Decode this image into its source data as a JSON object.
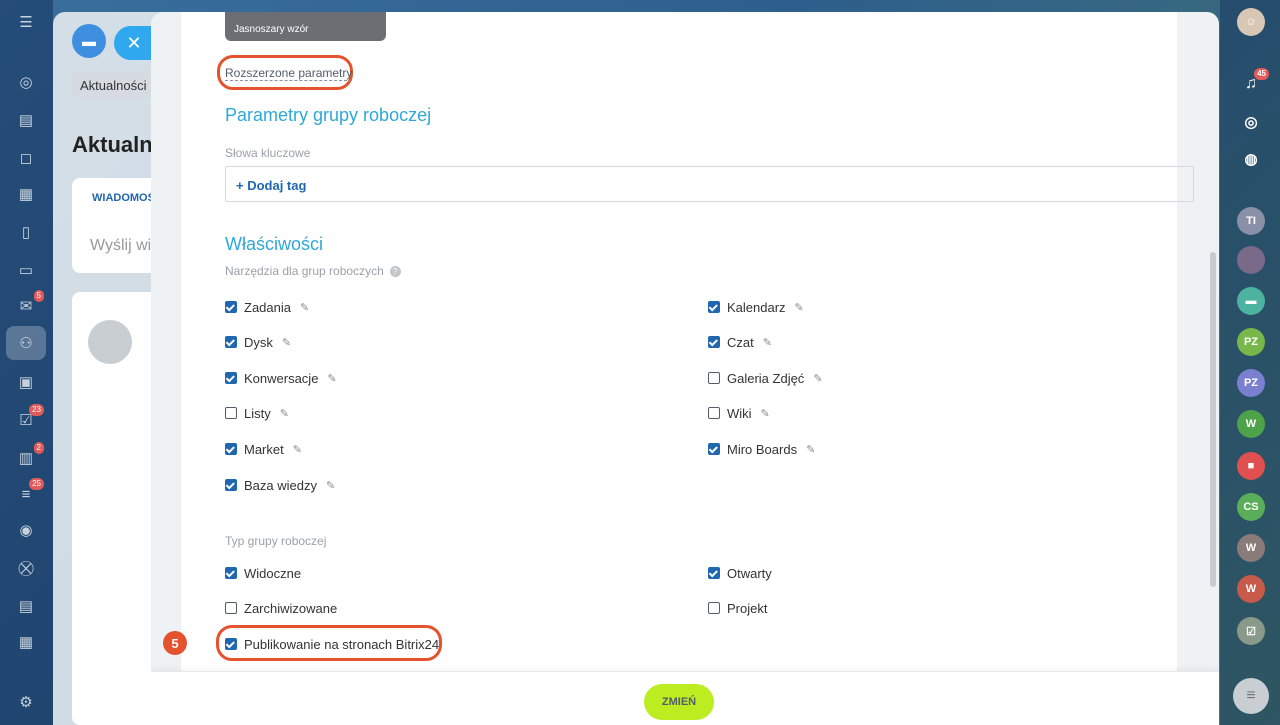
{
  "background": {
    "tab_label": "Aktualności",
    "page_title": "Aktualności",
    "card_tab": "WIADOMOŚĆ",
    "card_placeholder": "Wyślij wiadomość"
  },
  "left_sidebar": {
    "badges": {
      "mail": "5",
      "tasks": "23",
      "calendar2": "2",
      "funnel": "25"
    }
  },
  "right_sidebar": {
    "notifications_badge": "45",
    "avatars": [
      "TI",
      "PZ",
      "PZ",
      "W",
      "CS",
      "W",
      "W"
    ]
  },
  "modal": {
    "preset_label": "Jasnoszary wzór",
    "advanced_link": "Rozszerzone parametry",
    "group_params_title": "Parametry grupy roboczej",
    "keywords_label": "Słowa kluczowe",
    "add_tag_label": "+ Dodaj tag",
    "properties_title": "Właściwości",
    "tools_label": "Narzędzia dla grup roboczych",
    "tools": [
      {
        "label": "Zadania",
        "checked": true
      },
      {
        "label": "Dysk",
        "checked": true
      },
      {
        "label": "Konwersacje",
        "checked": true
      },
      {
        "label": "Listy",
        "checked": false
      },
      {
        "label": "Market",
        "checked": true
      },
      {
        "label": "Baza wiedzy",
        "checked": true
      },
      {
        "label": "Kalendarz",
        "checked": true
      },
      {
        "label": "Czat",
        "checked": true
      },
      {
        "label": "Galeria Zdjęć",
        "checked": false
      },
      {
        "label": "Wiki",
        "checked": false
      },
      {
        "label": "Miro Boards",
        "checked": true
      }
    ],
    "type_label": "Typ grupy roboczej",
    "types": [
      {
        "label": "Widoczne",
        "checked": true
      },
      {
        "label": "Zarchiwizowane",
        "checked": false
      },
      {
        "label": "Publikowanie na stronach Bitrix24",
        "checked": true
      },
      {
        "label": "Otwarty",
        "checked": true
      },
      {
        "label": "Projekt",
        "checked": false
      }
    ],
    "step_number": "5",
    "save_label": "ZMIEŃ"
  },
  "colors": {
    "accent": "#2fa8d8",
    "checkbox": "#2067b0",
    "highlight": "#e4532d",
    "save_button": "#bbed21"
  }
}
